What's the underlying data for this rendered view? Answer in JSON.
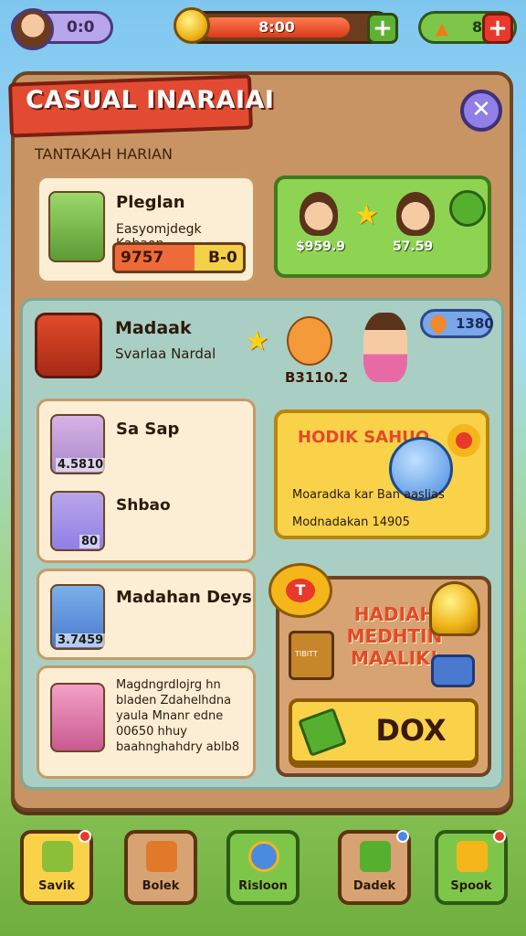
{
  "topbar": {
    "player_value": "0:0",
    "energy_value": "8:00",
    "energy_level": 0.88,
    "carrot_value": "8"
  },
  "panel": {
    "title": "CASUAL INARAIAI",
    "subtitle": "TANTAKAH HARIAN"
  },
  "card1": {
    "title": "Pleglan",
    "text": "Easyomjdegk Kahaon",
    "bar_left": "9757",
    "bar_right": "B-0"
  },
  "green_card": {
    "value_left": "$959.9",
    "value_right": "57.59"
  },
  "section": {
    "title": "Madaak",
    "text": "Svarlaa Nardal",
    "fox_value": "B3110.2",
    "gem_value": "1380"
  },
  "card2": {
    "item1_title": "Sa Sap",
    "item1_value": "4.5810",
    "item2_title": "Shbao",
    "item2_value": "80"
  },
  "yellow_card": {
    "title": "HODIK SAHUO",
    "line1": "Moaradka kar Ban aaslias",
    "line2": "Modnadakan 14905"
  },
  "card3": {
    "title": "Madahan Deys",
    "value": "3.7459"
  },
  "card4": {
    "text": "Magdngrdlojrg hn bladen Zdahelhdna yaula Mnanr edne 00650 hhuy baahnghahdry ablb8"
  },
  "reward": {
    "badge": "T",
    "title": "HADIAH MEDHTIN MAALIK!",
    "chest_label": "TIBITT",
    "claim_label": "DOX"
  },
  "bottom_nav": [
    {
      "label": "Savik"
    },
    {
      "label": "Bolek"
    },
    {
      "label": "Risloon"
    },
    {
      "label": "Dadek"
    },
    {
      "label": "Spook"
    }
  ],
  "colors": {
    "accent_red": "#e24b32",
    "accent_green": "#7ec64a",
    "accent_yellow": "#f9d24a",
    "panel_brown": "#c99463"
  }
}
